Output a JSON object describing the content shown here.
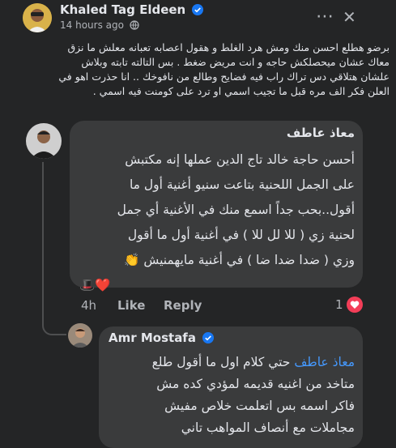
{
  "post": {
    "author": "Khaled Tag Eldeen",
    "time": "14 hours ago",
    "more_label": "⋯",
    "close_label": "✕",
    "text_lines": [
      "برضو هطلع احسن منك ومش هرد الغلط و هقول اعصابه تعبانه معلش ما نزق",
      "معاك عشان ميحصلكش حاجه و انت مريض ضغط . بس التالته تابته وبلاش",
      "علشان هتلاقي دس تراك راب فيه فضايح وطالع من نافوخك .. انا حذرت اهو في",
      "العلن فكر الف مره قبل ما تجيب اسمي او ترد على كومنت فيه اسمي ."
    ]
  },
  "comment1": {
    "author": "معاذ عاطف",
    "text_lines": [
      "أحسن حاجة خالد تاج الدين عملها إنه مكتبش",
      "على الجمل اللحنية بتاعت سنيو أغنية أول ما",
      "أقول..بحب جداً اسمع منك في الأغنية أي جمل",
      "لحنية زي ( للا لل للا ) في أغنية أول ما أقول",
      "وزي ( ضدا ضدا ضا ) في أغنية مايهمنيش 👏"
    ],
    "emoji_line": "🎩❤️",
    "time": "4h",
    "like_label": "Like",
    "reply_label": "Reply",
    "reaction_count": "1",
    "reaction_icon": "heart-reaction-icon"
  },
  "reply1": {
    "author": "Amr Mostafa",
    "mention": "معاذ عاطف",
    "first_line_rest": " حتي كلام اول ما أقول طلع",
    "text_lines": [
      "متاخد من اغنيه قديمه لمؤدي كده مش",
      "فاكر اسمه بس اتعلمت خلاص مفيش",
      "مجاملات مع أنصاف المواهب تاني"
    ]
  },
  "colors": {
    "page_bg": "#242526",
    "bubble_bg": "#3a3b3c",
    "text": "#e4e6eb",
    "muted": "#b0b3b8",
    "link": "#4599ff",
    "verified": "#1877f2",
    "heart": "#f33e58"
  }
}
